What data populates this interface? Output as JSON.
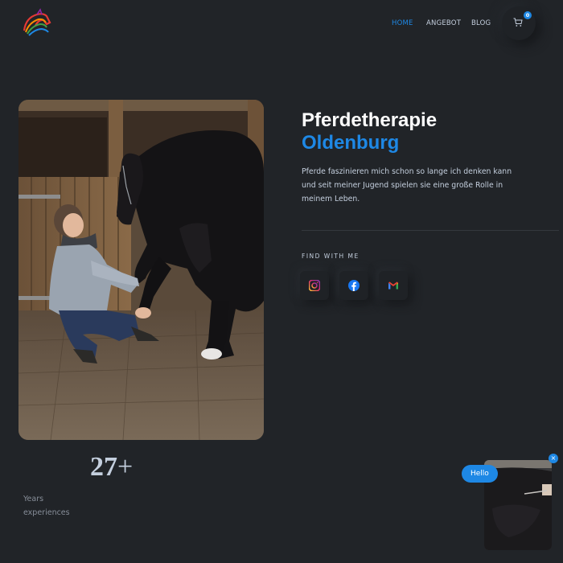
{
  "header": {
    "logo": "horse-rainbow-logo",
    "nav": [
      {
        "label": "HOME",
        "active": true
      },
      {
        "label": "ANGEBOT",
        "active": false
      },
      {
        "label": "BLOG",
        "active": false
      }
    ],
    "cart": {
      "icon": "cart-icon",
      "count": "0"
    }
  },
  "hero": {
    "title_line1": "Pferdetherapie",
    "title_line2": "Oldenburg",
    "description": "Pferde faszinieren mich schon so lange ich denken kann und seit meiner Jugend spielen sie eine große Rolle in meinem Leben.",
    "find_label": "FIND WITH ME",
    "social": [
      {
        "name": "instagram-icon"
      },
      {
        "name": "facebook-icon"
      },
      {
        "name": "gmail-icon"
      }
    ]
  },
  "stats": {
    "number": "27",
    "suffix": "+",
    "label_line1": "Years",
    "label_line2": "experiences"
  },
  "video_widget": {
    "greeting": "Hello",
    "close": "×"
  },
  "colors": {
    "background": "#212428",
    "accent": "#1e88e5",
    "text": "#c4cfde",
    "heading": "#ffffff"
  }
}
